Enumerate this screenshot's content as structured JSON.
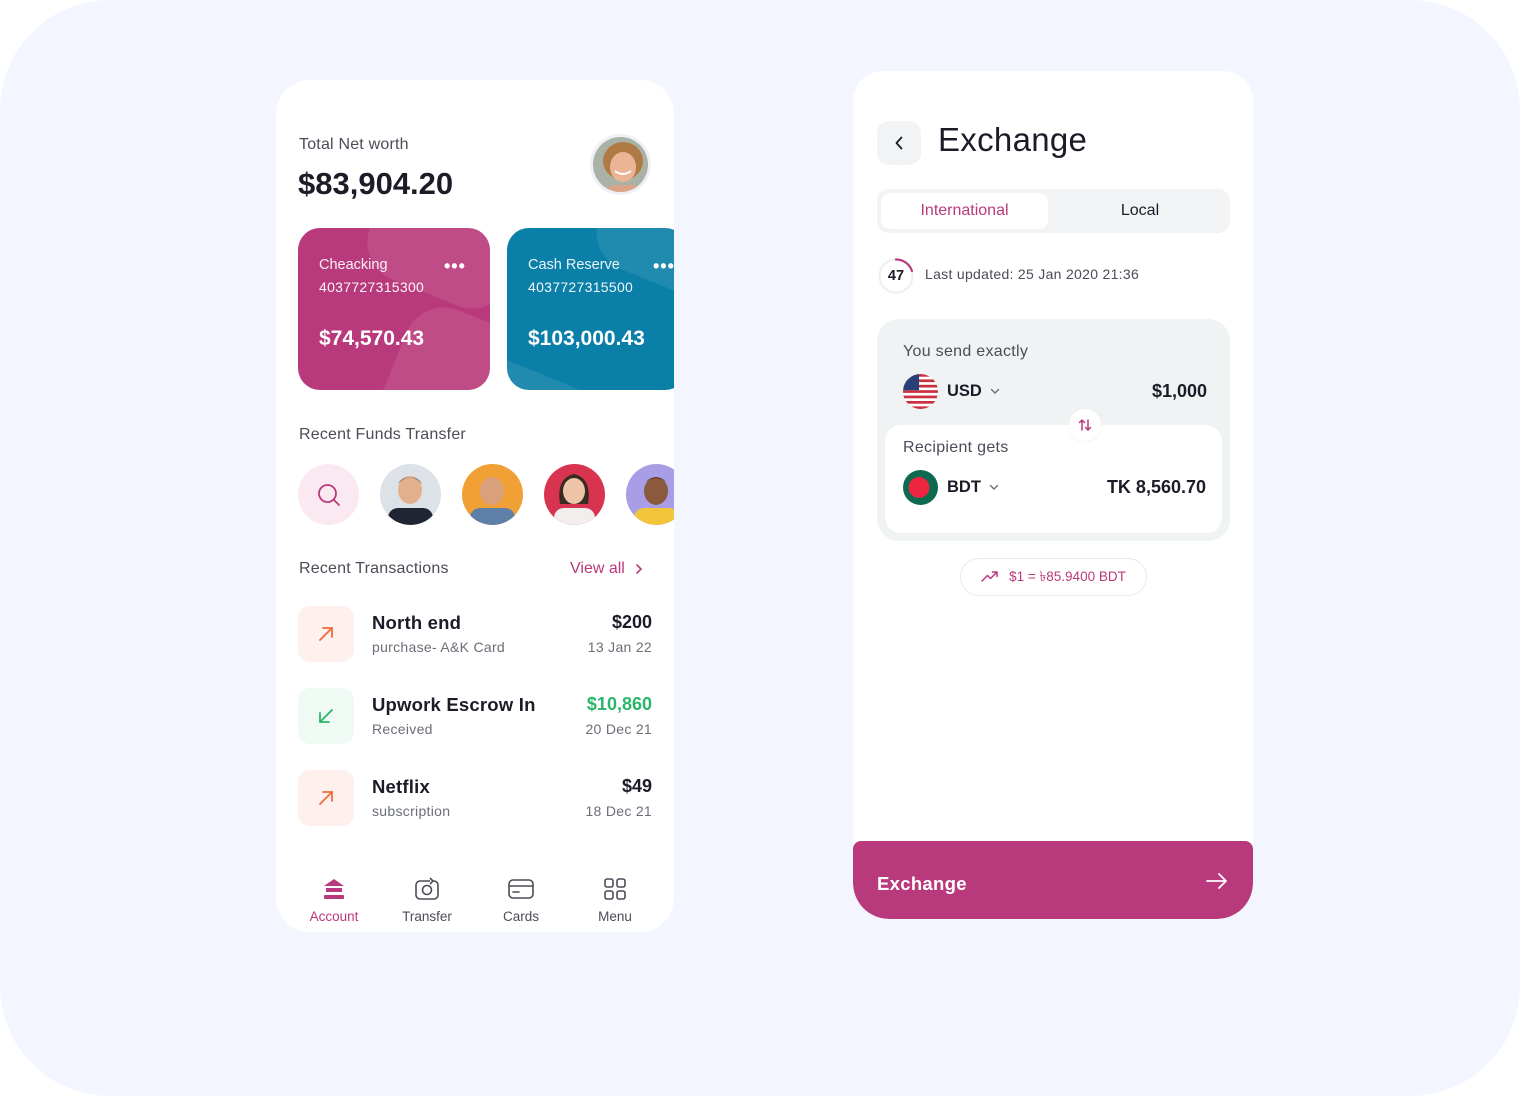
{
  "account_screen": {
    "net_worth_label": "Total Net worth",
    "net_worth_value": "$83,904.20",
    "cards": [
      {
        "name": "Cheacking",
        "number": "4037727315300",
        "balance": "$74,570.43",
        "color": "#b93a7c"
      },
      {
        "name": "Cash Reserve",
        "number": "4037727315500",
        "balance": "$103,000.43",
        "color": "#0a7fa8"
      }
    ],
    "recent_transfer_label": "Recent Funds Transfer",
    "recent_transactions_label": "Recent Transactions",
    "view_all_label": "View all",
    "transactions": [
      {
        "title": "North end",
        "subtitle": "purchase- A&K Card",
        "amount": "$200",
        "date": "13 Jan 22",
        "direction": "outgoing"
      },
      {
        "title": "Upwork Escrow In",
        "subtitle": "Received",
        "amount": "$10,860",
        "date": "20 Dec 21",
        "direction": "incoming"
      },
      {
        "title": "Netflix",
        "subtitle": "subscription",
        "amount": "$49",
        "date": "18 Dec 21",
        "direction": "outgoing"
      }
    ],
    "tabs": [
      {
        "label": "Account",
        "icon": "bank-icon",
        "active": true
      },
      {
        "label": "Transfer",
        "icon": "transfer-icon",
        "active": false
      },
      {
        "label": "Cards",
        "icon": "card-icon",
        "active": false
      },
      {
        "label": "Menu",
        "icon": "grid-icon",
        "active": false
      }
    ]
  },
  "exchange_screen": {
    "title": "Exchange",
    "segments": [
      "International",
      "Local"
    ],
    "active_segment": "International",
    "timer_value": "47",
    "last_updated": "Last updated: 25 Jan 2020 21:36",
    "send_label": "You send exactly",
    "send_currency": "USD",
    "send_amount": "$1,000",
    "receive_label": "Recipient gets",
    "receive_currency": "BDT",
    "receive_amount": "TK 8,560.70",
    "rate_text": "$1 = ৳85.9400 BDT",
    "cta_label": "Exchange"
  },
  "colors": {
    "accent": "#b93a7c",
    "teal": "#0a7fa8",
    "positive": "#2bb56b",
    "negative": "#f26b3a",
    "background": "#f3f6fe"
  }
}
